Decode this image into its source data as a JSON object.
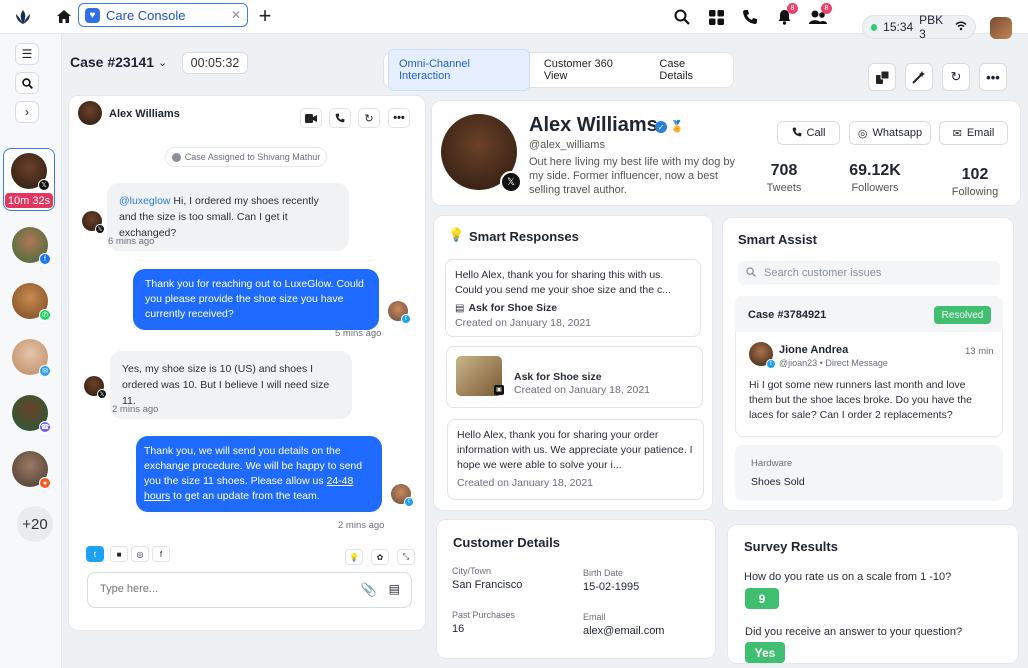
{
  "topbar": {
    "tab_label": "Care Console",
    "time": "15:34",
    "network": "PBK 3",
    "notif_badge": "8",
    "team_badge": "8"
  },
  "left_rail": {
    "active_timer": "10m 32s",
    "more_count": "+20"
  },
  "case": {
    "title": "Case #23141",
    "timer": "00:05:32",
    "tabs": [
      "Omni-Channel Interaction",
      "Customer 360 View",
      "Case Details"
    ]
  },
  "chat": {
    "contact_name": "Alex Williams",
    "assigned_note": "Case Assigned to Shivang Mathur",
    "messages": [
      {
        "mention": "@luxeglow",
        "text": " Hi, I ordered my shoes recently and the size is too small. Can I get it exchanged?",
        "time": "6 mins ago"
      },
      {
        "text": "Thank you for reaching out to LuxeGlow. Could you please provide the shoe size you have currently received?",
        "time": "5 mins ago"
      },
      {
        "text": "Yes, my shoe size is 10 (US) and shoes I ordered was 10. But I believe I will need size 11.",
        "time": "2 mins ago"
      },
      {
        "text_a": "Thank you, we will send you details on the exchange procedure. We will be happy to send you the size 11 shoes. Please allow us ",
        "link": "24-48 hours",
        "text_b": " to get an update from the team.",
        "time": "2 mins ago"
      }
    ],
    "compose_placeholder": "Type here..."
  },
  "profile": {
    "name": "Alex Williams",
    "handle": "@alex_williams",
    "bio": "Out here living my best life with my dog by my side. Former influencer, now a best selling travel author.",
    "buttons": [
      "Call",
      "Whatsapp",
      "Email"
    ],
    "stats": [
      {
        "value": "708",
        "label": "Tweets"
      },
      {
        "value": "69.12K",
        "label": "Followers"
      },
      {
        "value": "102",
        "label": "Following"
      }
    ]
  },
  "smart_responses": {
    "title": "Smart Responses",
    "cards": [
      {
        "text": "Hello Alex, thank you for sharing this with us. Could you send me your shoe size and the c...",
        "title": "Ask for Shoe Size",
        "date": "Created on January 18, 2021"
      },
      {
        "title": "Ask for Shoe size",
        "date": "Created on January 18, 2021"
      },
      {
        "text": "Hello Alex, thank you for sharing your order information with us. We appreciate your patience. I hope we were able to solve your i...",
        "date": "Created on January 18, 2021"
      }
    ]
  },
  "smart_assist": {
    "title": "Smart Assist",
    "search_placeholder": "Search customer issues",
    "case_id": "Case #3784921",
    "case_status": "Resolved",
    "author": "Jione Andrea",
    "author_meta": "@jioan23 • Direct Message",
    "author_time": "13 min",
    "message": "Hi I got some new runners last month and love them but the shoe laces broke. Do you have the laces for sale? Can I order 2 replacements?",
    "category_label": "Hardware",
    "category_value": "Shoes Sold"
  },
  "customer_details": {
    "title": "Customer Details",
    "city_label": "City/Town",
    "city": "San Francisco",
    "birth_label": "Birth Date",
    "birth": "15-02-1995",
    "purchases_label": "Past Purchases",
    "purchases": "16",
    "email_label": "Email",
    "email": "alex@email.com"
  },
  "survey": {
    "title": "Survey Results",
    "q1": "How do you rate us on a scale from 1 -10?",
    "a1": "9",
    "q2": "Did you receive an answer to your question?",
    "a2": "Yes"
  }
}
